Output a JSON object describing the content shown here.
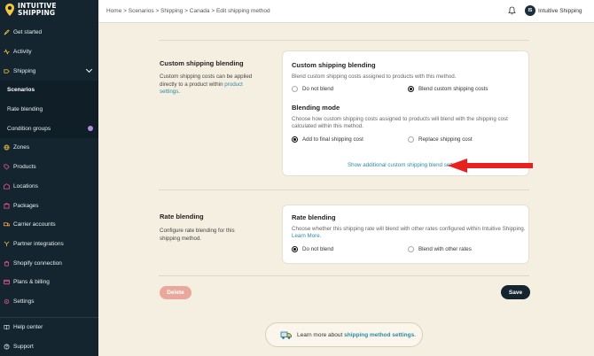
{
  "brand": {
    "name_line1": "INTUITIVE",
    "name_line2": "SHIPPING",
    "colors": {
      "sidebar": "#14252f",
      "accent": "#2d8aa5",
      "background": "#f5efe1",
      "delete": "#e9a89b",
      "arrow": "#e8211e"
    }
  },
  "sidebar": {
    "items": [
      {
        "label": "Get started",
        "icon": "rocket-icon"
      },
      {
        "label": "Activity",
        "icon": "activity-icon"
      },
      {
        "label": "Shipping",
        "icon": "shipping-icon"
      },
      {
        "label": "Scenarios"
      },
      {
        "label": "Rate blending"
      },
      {
        "label": "Condition groups"
      },
      {
        "label": "Zones",
        "icon": "globe-icon"
      },
      {
        "label": "Products",
        "icon": "tag-icon"
      },
      {
        "label": "Locations",
        "icon": "location-icon"
      },
      {
        "label": "Packages",
        "icon": "package-icon"
      },
      {
        "label": "Carrier accounts",
        "icon": "truck-icon"
      },
      {
        "label": "Partner integrations",
        "icon": "integration-icon"
      },
      {
        "label": "Shopify connection",
        "icon": "shopify-icon"
      },
      {
        "label": "Plans & billing",
        "icon": "card-icon"
      },
      {
        "label": "Settings",
        "icon": "gear-icon"
      }
    ],
    "bottom": [
      {
        "label": "Help center",
        "icon": "book-icon"
      },
      {
        "label": "Support",
        "icon": "support-icon"
      }
    ]
  },
  "header": {
    "breadcrumb": "Home > Scenarios > Shipping > Canada > Edit shipping method",
    "avatar_initials": "IS",
    "user_name": "Intuitive Shipping"
  },
  "custom_section": {
    "title": "Custom shipping blending",
    "desc_before": "Custom shipping costs can be applied directly to a product within ",
    "desc_link": "product settings",
    "desc_after": ".",
    "card": {
      "title": "Custom shipping blending",
      "desc": "Blend custom shipping costs assigned to products with this method.",
      "options": [
        {
          "label": "Do not blend",
          "selected": false
        },
        {
          "label": "Blend custom shipping costs",
          "selected": true
        }
      ],
      "mode_title": "Blending mode",
      "mode_desc": "Choose how custom shipping costs assigned to products will blend with the shipping cost calculated within this method.",
      "mode_options": [
        {
          "label": "Add to final shipping cost",
          "selected": true
        },
        {
          "label": "Replace shipping cost",
          "selected": false
        }
      ],
      "more_link": "Show additional custom shipping blend settings"
    }
  },
  "rate_section": {
    "title": "Rate blending",
    "desc": "Configure rate blending for this shipping method.",
    "card": {
      "title": "Rate blending",
      "desc": "Choose whether this shipping rate will blend with other rates configured within Intuitive Shipping.",
      "learn_link": "Learn More.",
      "options": [
        {
          "label": "Do not blend",
          "selected": true
        },
        {
          "label": "Blend with other rates",
          "selected": false
        }
      ]
    }
  },
  "actions": {
    "delete_label": "Delete",
    "save_label": "Save"
  },
  "learn_more": {
    "prefix": "Learn more about ",
    "link": "shipping method settings",
    "suffix": "."
  }
}
